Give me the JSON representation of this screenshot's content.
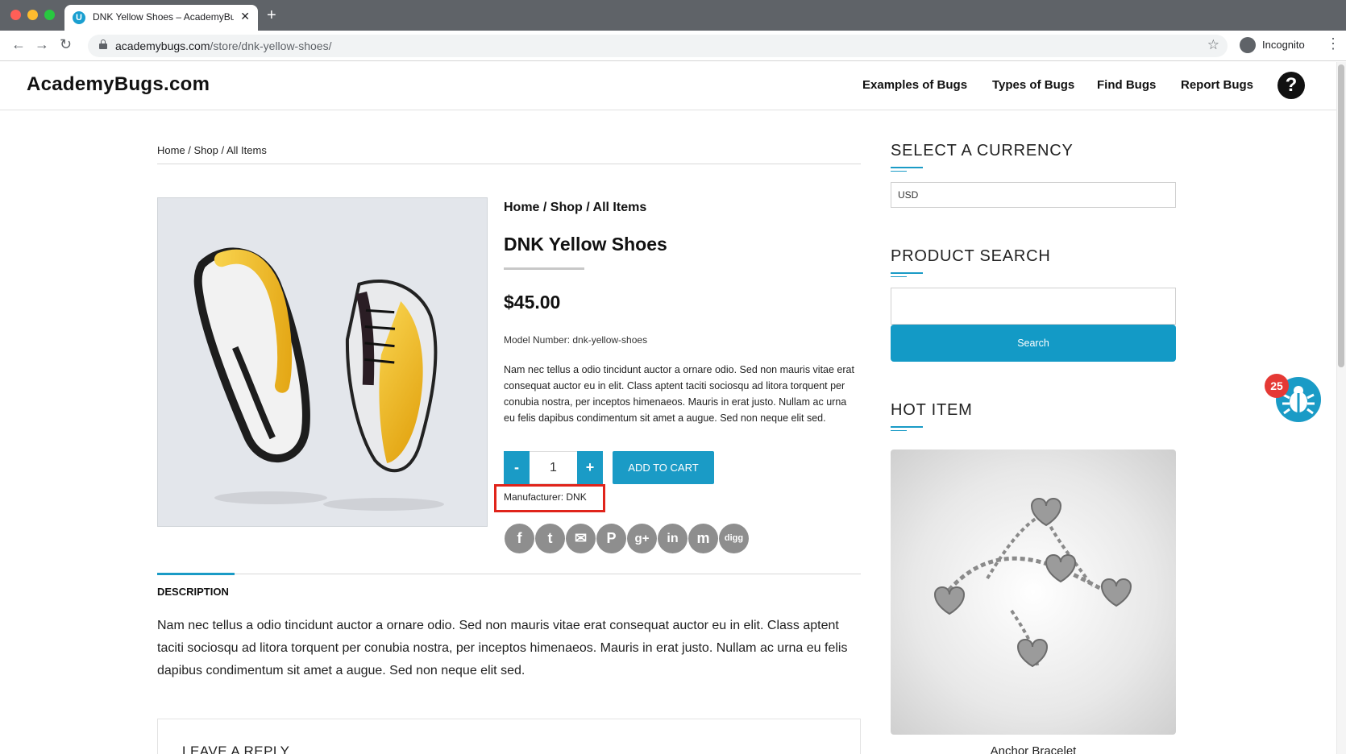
{
  "browser": {
    "tab_title": "DNK Yellow Shoes – AcademyBugs.com",
    "tab_favicon_letter": "U",
    "url_domain": "academybugs.com",
    "url_path": "/store/dnk-yellow-shoes/",
    "profile_label": "Incognito"
  },
  "site": {
    "logo": "AcademyBugs.com",
    "nav": [
      "Examples of Bugs",
      "Types of Bugs",
      "Find Bugs",
      "Report Bugs"
    ],
    "help_label": "?"
  },
  "product": {
    "breadcrumb_top": "Home / Shop / All Items",
    "breadcrumb_bold": "Home / Shop / All Items",
    "title": "DNK Yellow Shoes",
    "price": "$45.00",
    "model": "Model Number: dnk-yellow-shoes",
    "short_description": "Nam nec tellus a odio tincidunt auctor a ornare odio. Sed non mauris vitae erat consequat auctor eu in elit. Class aptent taciti sociosqu ad litora torquent per conubia nostra, per inceptos himenaeos. Mauris in erat justo. Nullam ac urna eu felis dapibus condimentum sit amet a augue. Sed non neque elit sed.",
    "qty_minus": "-",
    "qty_value": "1",
    "qty_plus": "+",
    "add_to_cart": "ADD TO CART",
    "manufacturer": "Manufacturer: DNK",
    "share_icons": [
      {
        "name": "facebook-icon",
        "glyph": "f"
      },
      {
        "name": "twitter-icon",
        "glyph": "t"
      },
      {
        "name": "email-icon",
        "glyph": "✉"
      },
      {
        "name": "pinterest-icon",
        "glyph": "P"
      },
      {
        "name": "googleplus-icon",
        "glyph": "g+"
      },
      {
        "name": "linkedin-icon",
        "glyph": "in"
      },
      {
        "name": "myspace-icon",
        "glyph": "m"
      },
      {
        "name": "digg-icon",
        "glyph": "digg"
      }
    ],
    "description_tab": "DESCRIPTION",
    "description": "Nam nec tellus a odio tincidunt auctor a ornare odio. Sed non mauris vitae erat consequat auctor eu in elit. Class aptent taciti sociosqu ad litora torquent per conubia nostra, per inceptos himenaeos. Mauris in erat justo. Nullam ac urna eu felis dapibus condimentum sit amet a augue. Sed non neque elit sed.",
    "leave_reply": "LEAVE A REPLY"
  },
  "sidebar": {
    "currency_heading": "SELECT A CURRENCY",
    "currency_value": "USD",
    "search_heading": "PRODUCT SEARCH",
    "search_placeholder": "",
    "search_button": "Search",
    "hot_heading": "HOT ITEM",
    "hot_item_caption": "Anchor Bracelet"
  },
  "widget": {
    "bug_count": "25"
  },
  "colors": {
    "accent": "#1a9bc6",
    "highlight_box": "#e0241b",
    "badge": "#e53935"
  }
}
